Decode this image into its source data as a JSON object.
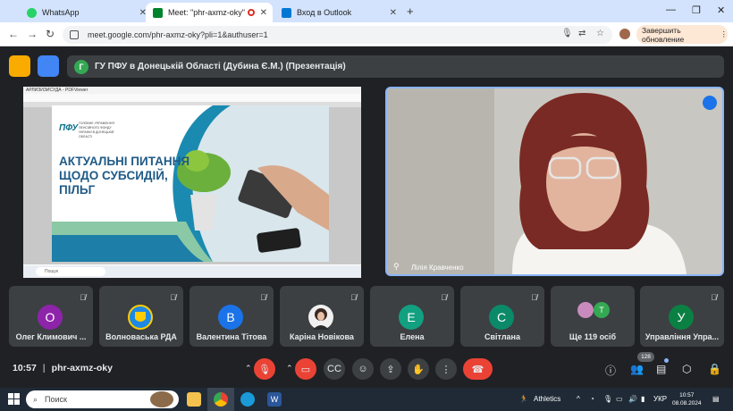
{
  "browser": {
    "tabs": [
      {
        "label": "WhatsApp",
        "color": "#25d366"
      },
      {
        "label": "Meet: \"phr-axmz-oky\"",
        "color": "#00832d"
      },
      {
        "label": "Вход в Outlook",
        "color": "#0078d4"
      }
    ],
    "url": "meet.google.com/phr-axmz-oky?pli=1&authuser=1",
    "update_label": "Завершить обновление"
  },
  "meet": {
    "meeting_title": "ГУ ПФУ в Донецькій Області (Дубина Є.М.) (Презентація)",
    "presentation": {
      "app_title": "АРЛИЗИЗИСУДА - PDFViewer",
      "logo": "ПФУ",
      "logo_subtitle": "ГОЛОВНЕ УПРАВЛІННЯ ПЕНСІЙНОГО ФОНДУ УКРАЇНИ В ДОНЕЦЬКІЙ ОБЛАСТІ",
      "headline_lines": [
        "АКТУАЛЬНІ ПИТАННЯ",
        "ЩОДО СУБСИДІЙ,",
        "ПІЛЬГ"
      ],
      "taskbar_search": "Пошук"
    },
    "speaker_name": "Лілія Кравченко",
    "participants": [
      {
        "name": "Олег Климович ...",
        "initial": "О",
        "color": "#8e24aa"
      },
      {
        "name": "Волноваська РДА",
        "initial": "",
        "color": "#1e88e5"
      },
      {
        "name": "Валентина Тітова",
        "initial": "В",
        "color": "#1a73e8"
      },
      {
        "name": "Каріна Новікова",
        "initial": "",
        "color": "#f0f0f0"
      },
      {
        "name": "Елена",
        "initial": "Е",
        "color": "#12a080"
      },
      {
        "name": "Світлана",
        "initial": "С",
        "color": "#0b8a6a"
      },
      {
        "name": "Ще 119 осіб",
        "initial": "Т",
        "color": "#34a853"
      },
      {
        "name": "Управління Упра...",
        "initial": "У",
        "color": "#0b8043"
      }
    ],
    "time": "10:57",
    "meeting_code": "phr-axmz-oky",
    "people_count": "128"
  },
  "windows": {
    "search_placeholder": "Поиск",
    "weather": "Athletics",
    "lang": "УКР",
    "clock_time": "10:57",
    "clock_date": "08.08.2024"
  }
}
